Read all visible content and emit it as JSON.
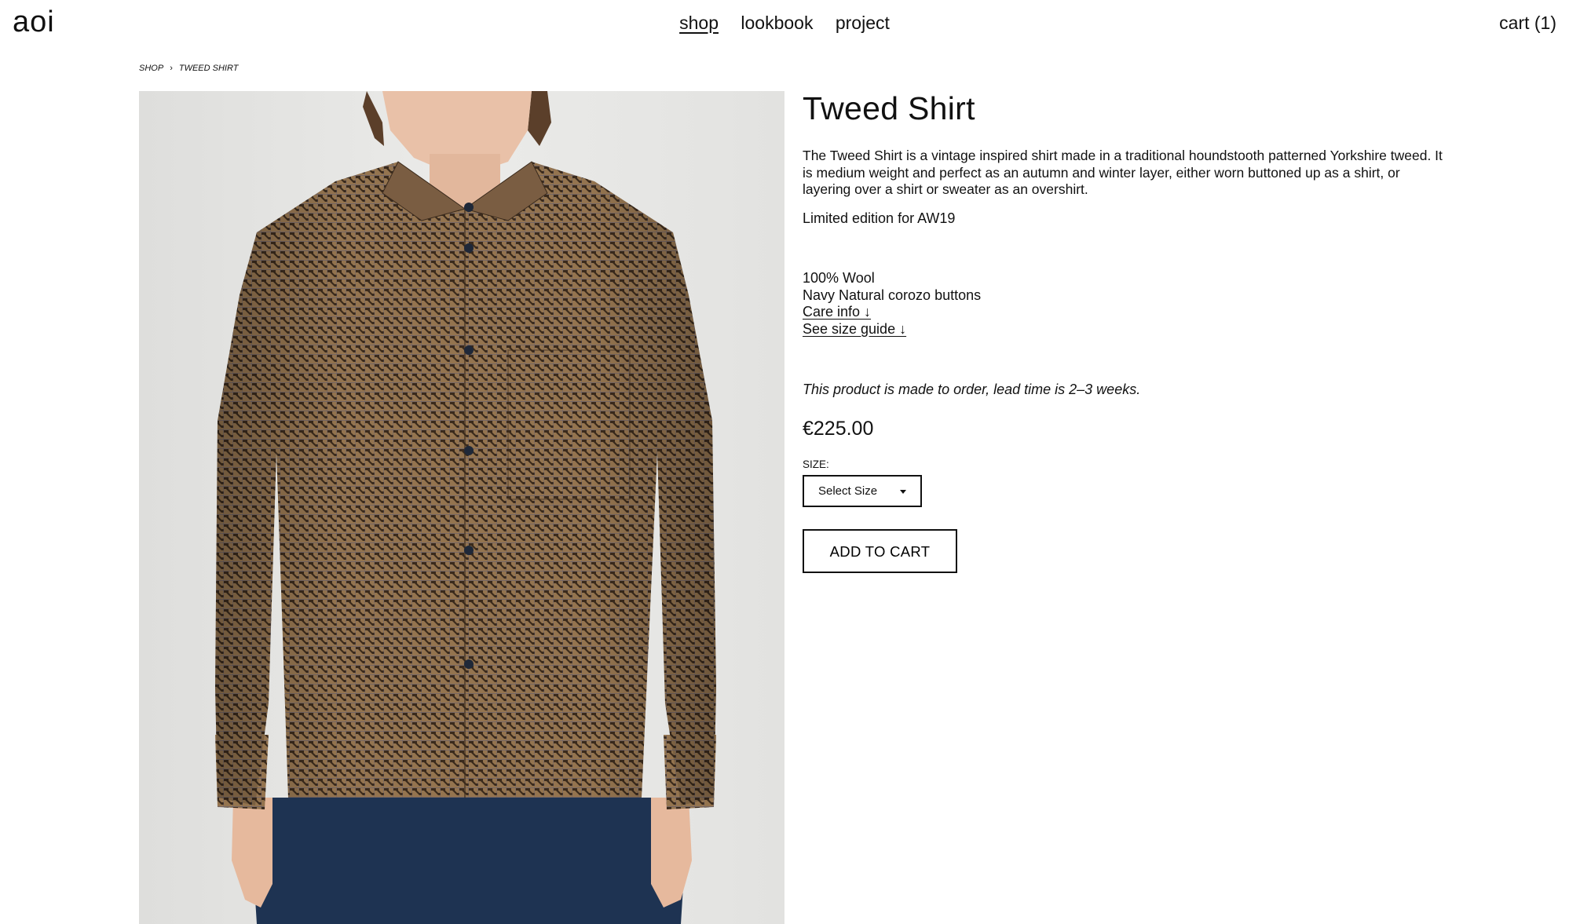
{
  "header": {
    "logo": "aoi",
    "nav": [
      {
        "label": "shop",
        "active": true
      },
      {
        "label": "lookbook",
        "active": false
      },
      {
        "label": "project",
        "active": false
      }
    ],
    "cart_label": "cart (1)"
  },
  "breadcrumb": {
    "items": [
      "SHOP",
      "TWEED SHIRT"
    ],
    "separator": "›"
  },
  "product": {
    "image_alt": "Tweed Shirt",
    "title": "Tweed Shirt",
    "description": "The Tweed Shirt is a vintage inspired shirt made in a traditional houndstooth patterned Yorkshire tweed. It is medium weight and perfect as an autumn and winter layer, either worn buttoned up as a shirt, or layering over a shirt or sweater as an overshirt.",
    "edition": "Limited edition for AW19",
    "material": "100% Wool",
    "buttons": "Navy Natural corozo buttons",
    "care_link": "Care info ↓",
    "size_guide_link": "See size guide ↓",
    "lead_time": "This product is made to order, lead time is 2–3 weeks.",
    "price": "€225.00",
    "size_label": "SIZE:",
    "size_select_value": "Select Size",
    "add_to_cart_label": "ADD TO CART"
  },
  "colors": {
    "text": "#111111",
    "background": "#ffffff",
    "image_wall": "#e6e6e4",
    "shirt_base": "#8a6d4f",
    "trousers": "#1e3352"
  }
}
